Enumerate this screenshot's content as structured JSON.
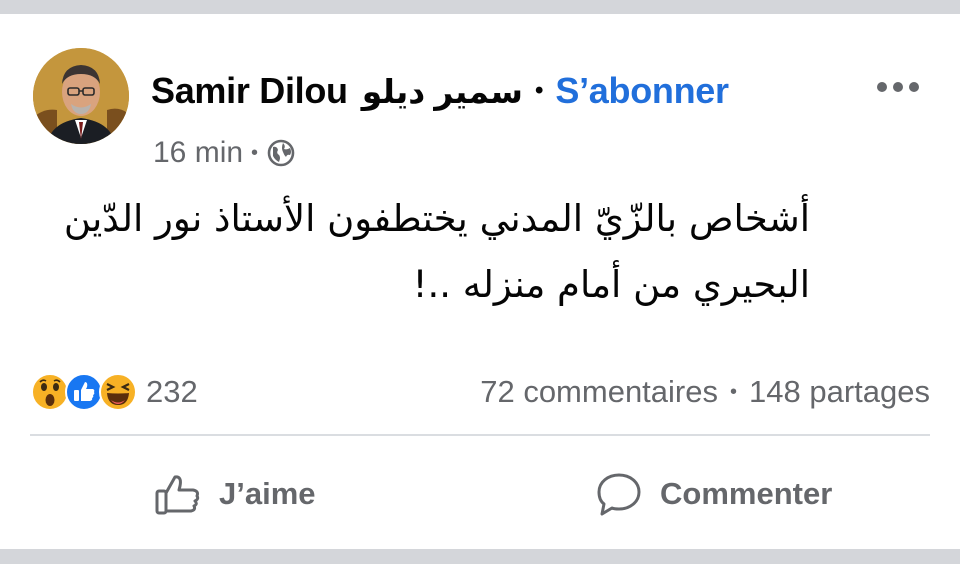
{
  "post": {
    "author": {
      "name": "Samir Dilou",
      "name_arabic": "سمير ديلو",
      "follow_label": "S’abonner"
    },
    "meta": {
      "time": "16 min",
      "privacy_icon": "globe-icon"
    },
    "more_icon": "more-options-icon",
    "text_lines": [
      "أشخاص بالزّيّ المدني يختطفون الأستاذ نور الدّين",
      "البحيري من أمام منزله ..!"
    ]
  },
  "reactions": {
    "icons": [
      "wow-reaction-icon",
      "like-reaction-icon",
      "haha-reaction-icon"
    ],
    "count": "232"
  },
  "stats": {
    "comments": "72 commentaires",
    "shares": "148 partages"
  },
  "actions": {
    "like_label": "J’aime",
    "like_icon": "thumbs-up-icon",
    "comment_label": "Commenter",
    "comment_icon": "comment-bubble-icon"
  },
  "colors": {
    "accent_link": "#216fdb",
    "text_primary": "#050505",
    "text_secondary": "#65676b",
    "like_blue": "#1877f2",
    "reaction_yellow": "#f7b125"
  }
}
